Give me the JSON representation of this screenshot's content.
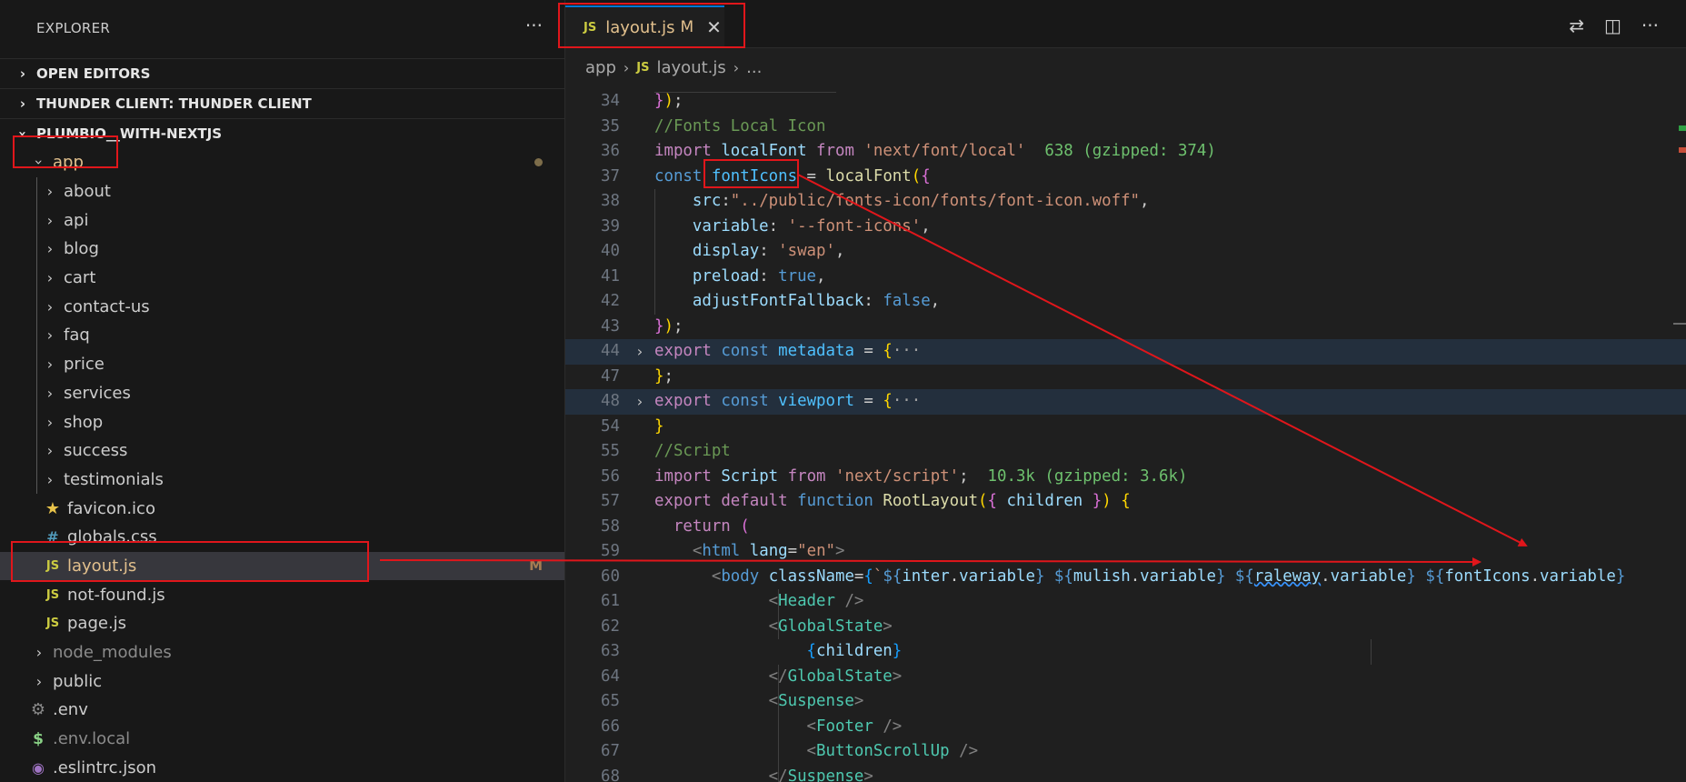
{
  "sidebar": {
    "title": "EXPLORER",
    "more": "···",
    "sections": {
      "open_editors": "OPEN EDITORS",
      "thunder": "THUNDER CLIENT: THUNDER CLIENT",
      "project": "PLUMBIO__WITH-NEXTJS"
    },
    "app_folder": "app",
    "folders": [
      "about",
      "api",
      "blog",
      "cart",
      "contact-us",
      "faq",
      "price",
      "services",
      "shop",
      "success",
      "testimonials"
    ],
    "app_files": {
      "favicon": "favicon.ico",
      "globals": "globals.css",
      "layout": "layout.js",
      "layout_badge": "M",
      "notfound": "not-found.js",
      "page": "page.js"
    },
    "root": {
      "node_modules": "node_modules",
      "public": "public",
      "env": ".env",
      "env_local": ".env.local",
      "eslintrc": ".eslintrc.json"
    },
    "icon_js": "JS",
    "icon_css": "#"
  },
  "editor": {
    "tab_label": "layout.js",
    "tab_badge": "M",
    "breadcrumb": [
      "app",
      "layout.js",
      "..."
    ],
    "lines": [
      {
        "n": "34",
        "html": "<span class=\"b2\">}</span><span class=\"b1\">)</span>;"
      },
      {
        "n": "35",
        "html": "<span class=\"c\">//Fonts Local Icon</span>"
      },
      {
        "n": "36",
        "html": "<span class=\"kc\">import</span> <span class=\"v\">localFont</span> <span class=\"kc\">from</span> <span class=\"s\">'next/font/local'</span>  <span class=\"hint\">638 (gzipped: 374)</span>"
      },
      {
        "n": "37",
        "html": "<span class=\"k\">const</span> <span class=\"cn\">fontIcons</span> = <span class=\"f\">localFont</span><span class=\"b1\">(</span><span class=\"b2\">{</span>"
      },
      {
        "n": "38",
        "html": "    <span class=\"v\">src</span>:<span class=\"s\">\"../public/fonts-icon/fonts/font-icon.woff\"</span>,"
      },
      {
        "n": "39",
        "html": "    <span class=\"v\">variable</span>: <span class=\"s\">'--font-icons'</span>,"
      },
      {
        "n": "40",
        "html": "    <span class=\"v\">display</span>: <span class=\"s\">'swap'</span>,"
      },
      {
        "n": "41",
        "html": "    <span class=\"v\">preload</span>: <span class=\"k\">true</span>,"
      },
      {
        "n": "42",
        "html": "    <span class=\"v\">adjustFontFallback</span>: <span class=\"k\">false</span>,"
      },
      {
        "n": "43",
        "html": "<span class=\"b2\">}</span><span class=\"b1\">)</span>;"
      },
      {
        "n": "44",
        "html": "<span class=\"kc\">export</span> <span class=\"k\">const</span> <span class=\"cn\">metadata</span> = <span class=\"b1\">{</span><span class=\"el\">···</span>"
      },
      {
        "n": "47",
        "html": "<span class=\"b1\">}</span>;"
      },
      {
        "n": "48",
        "html": "<span class=\"kc\">export</span> <span class=\"k\">const</span> <span class=\"cn\">viewport</span> = <span class=\"b1\">{</span><span class=\"el\">···</span>"
      },
      {
        "n": "54",
        "html": "<span class=\"b1\">}</span>"
      },
      {
        "n": "55",
        "html": "<span class=\"c\">//Script</span>"
      },
      {
        "n": "56",
        "html": "<span class=\"kc\">import</span> <span class=\"v\">Script</span> <span class=\"kc\">from</span> <span class=\"s\">'next/script'</span>;  <span class=\"hint\">10.3k (gzipped: 3.6k)</span>"
      },
      {
        "n": "57",
        "html": "<span class=\"kc\">export</span> <span class=\"kc\">default</span> <span class=\"k\">function</span> <span class=\"f\">RootLayout</span><span class=\"b1\">(</span><span class=\"b2\">{</span> <span class=\"v\">children</span> <span class=\"b2\">}</span><span class=\"b1\">)</span> <span class=\"b1\">{</span>"
      },
      {
        "n": "58",
        "html": "  <span class=\"kc\">return</span> <span class=\"b2\">(</span>"
      },
      {
        "n": "59",
        "html": "    <span class=\"tg\">&lt;</span><span class=\"k\">html</span> <span class=\"v\">lang</span>=<span class=\"s\">\"en\"</span><span class=\"tg\">&gt;</span>"
      },
      {
        "n": "60",
        "html": "      <span class=\"tg\">&lt;</span><span class=\"k\">body</span> <span class=\"v\">className</span>=<span class=\"b3\">{</span><span class=\"s\">`</span><span class=\"k\">${</span><span class=\"v\">inter</span>.<span class=\"v\">variable</span><span class=\"k\">}</span><span class=\"s\"> </span><span class=\"k\">${</span><span class=\"v\">mulish</span>.<span class=\"v\">variable</span><span class=\"k\">}</span><span class=\"s\"> </span><span class=\"k\">${</span><span class=\"v sq\">raleway</span>.<span class=\"v\">variable</span><span class=\"k\">}</span><span class=\"s\"> </span><span class=\"k\">${</span><span class=\"v\">fontIcons</span>.<span class=\"v\">variable</span><span class=\"k\">}</span>"
      },
      {
        "n": "61",
        "html": "            <span class=\"tg\">&lt;</span><span class=\"t\">Header</span> <span class=\"tg\">/&gt;</span>"
      },
      {
        "n": "62",
        "html": "            <span class=\"tg\">&lt;</span><span class=\"t\">GlobalState</span><span class=\"tg\">&gt;</span>"
      },
      {
        "n": "63",
        "html": "                <span class=\"b3\">{</span><span class=\"v\">children</span><span class=\"b3\">}</span>"
      },
      {
        "n": "64",
        "html": "            <span class=\"tg\">&lt;/</span><span class=\"t\">GlobalState</span><span class=\"tg\">&gt;</span>"
      },
      {
        "n": "65",
        "html": "            <span class=\"tg\">&lt;</span><span class=\"t\">Suspense</span><span class=\"tg\">&gt;</span>"
      },
      {
        "n": "66",
        "html": "                <span class=\"tg\">&lt;</span><span class=\"t\">Footer</span> <span class=\"tg\">/&gt;</span>"
      },
      {
        "n": "67",
        "html": "                <span class=\"tg\">&lt;</span><span class=\"t\">ButtonScrollUp</span> <span class=\"tg\">/&gt;</span>"
      },
      {
        "n": "68",
        "html": "            <span class=\"tg\">&lt;/</span><span class=\"t\">Suspense</span><span class=\"tg\">&gt;</span>"
      }
    ]
  }
}
